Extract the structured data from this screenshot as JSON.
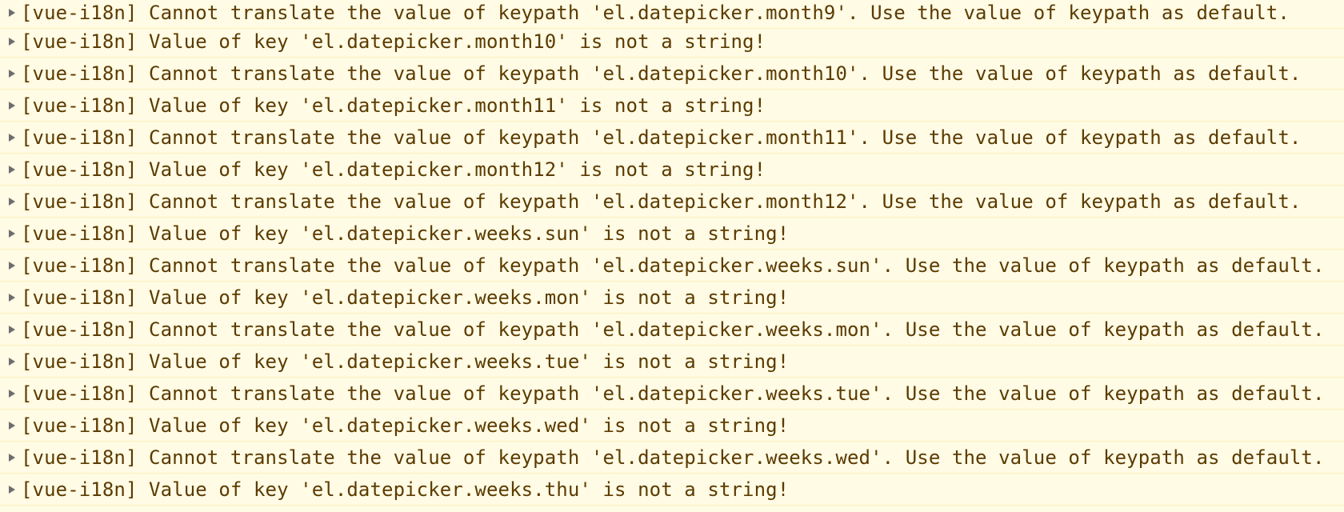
{
  "console": {
    "background": "#fffbe5",
    "text_color": "#5c3b00",
    "disclosure_icon": "triangle-right-icon",
    "messages": [
      "[vue-i18n] Cannot translate the value of keypath 'el.datepicker.month9'. Use the value of keypath as default.",
      "[vue-i18n] Value of key 'el.datepicker.month10' is not a string!",
      "[vue-i18n] Cannot translate the value of keypath 'el.datepicker.month10'. Use the value of keypath as default.",
      "[vue-i18n] Value of key 'el.datepicker.month11' is not a string!",
      "[vue-i18n] Cannot translate the value of keypath 'el.datepicker.month11'. Use the value of keypath as default.",
      "[vue-i18n] Value of key 'el.datepicker.month12' is not a string!",
      "[vue-i18n] Cannot translate the value of keypath 'el.datepicker.month12'. Use the value of keypath as default.",
      "[vue-i18n] Value of key 'el.datepicker.weeks.sun' is not a string!",
      "[vue-i18n] Cannot translate the value of keypath 'el.datepicker.weeks.sun'. Use the value of keypath as default.",
      "[vue-i18n] Value of key 'el.datepicker.weeks.mon' is not a string!",
      "[vue-i18n] Cannot translate the value of keypath 'el.datepicker.weeks.mon'. Use the value of keypath as default.",
      "[vue-i18n] Value of key 'el.datepicker.weeks.tue' is not a string!",
      "[vue-i18n] Cannot translate the value of keypath 'el.datepicker.weeks.tue'. Use the value of keypath as default.",
      "[vue-i18n] Value of key 'el.datepicker.weeks.wed' is not a string!",
      "[vue-i18n] Cannot translate the value of keypath 'el.datepicker.weeks.wed'. Use the value of keypath as default.",
      "[vue-i18n] Value of key 'el.datepicker.weeks.thu' is not a string!"
    ]
  }
}
